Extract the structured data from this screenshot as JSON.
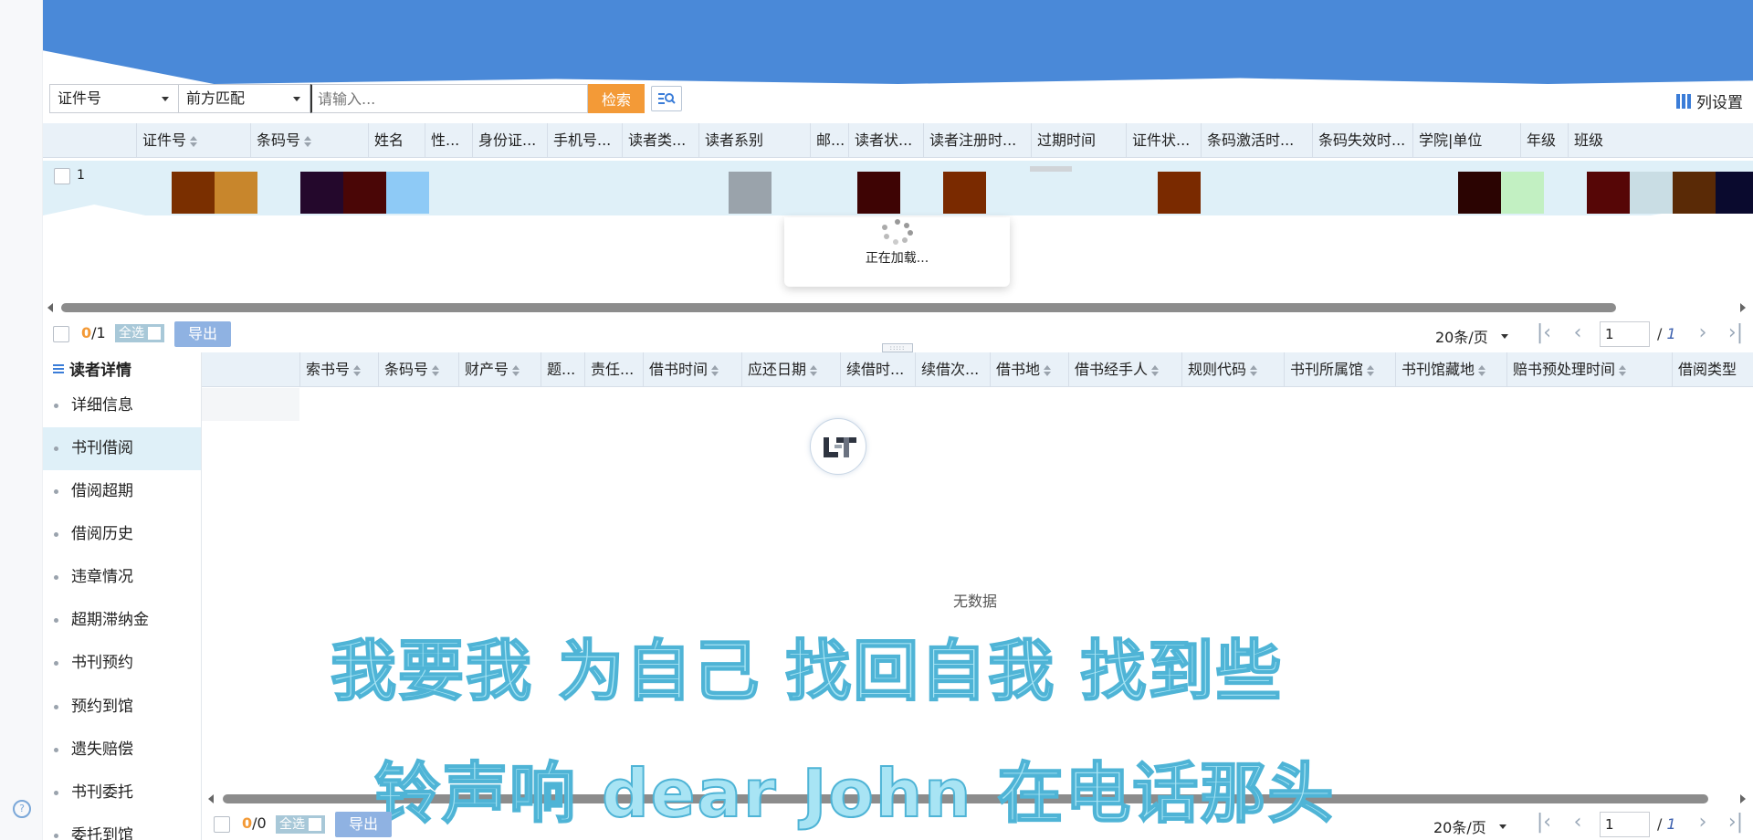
{
  "search": {
    "field_select": "证件号",
    "match_select": "前方匹配",
    "placeholder": "请输入...",
    "search_label": "检索",
    "column_settings_label": "列设置"
  },
  "upper_table": {
    "columns": [
      "证件号",
      "条码号",
      "姓名",
      "性...",
      "身份证...",
      "手机号...",
      "读者类...",
      "读者系别",
      "邮...",
      "读者状...",
      "读者注册时...",
      "过期时间",
      "证件状...",
      "条码激活时...",
      "条码失效时...",
      "学院|单位",
      "年级",
      "班级"
    ],
    "row_index": "1",
    "loading_text": "正在加载...",
    "swatch_colors": [
      "#7a2f00",
      "#c8862c",
      "#24082c",
      "#4a0606",
      "#8ecaf6",
      "#9aa3ab",
      "#3e0404",
      "#7a2a00",
      "#7a2a00",
      "#2b0402",
      "#c2f0c2",
      "#560606",
      "#c9dde4",
      "#5a2a06",
      "#0a0a2e"
    ]
  },
  "upper_pager": {
    "selected": "0",
    "total": "/1",
    "select_all": "全选",
    "export": "导出",
    "page_size": "20条/页",
    "page_input": "1",
    "page_sep": "/",
    "page_total": "1"
  },
  "sidebar": {
    "title": "读者详情",
    "items": [
      "详细信息",
      "书刊借阅",
      "借阅超期",
      "借阅历史",
      "违章情况",
      "超期滞纳金",
      "书刊预约",
      "预约到馆",
      "遗失赔偿",
      "书刊委托",
      "委托到馆"
    ],
    "active_index": 1
  },
  "lower_table": {
    "columns": [
      "索书号",
      "条码号",
      "财产号",
      "题...",
      "责任...",
      "借书时间",
      "应还日期",
      "续借时...",
      "续借次...",
      "借书地",
      "借书经手人",
      "规则代码",
      "书刊所属馆",
      "书刊馆藏地",
      "赔书预处理时间",
      "借阅类型"
    ],
    "empty_text": "无数据"
  },
  "lower_pager": {
    "selected": "0",
    "total": "/0",
    "select_all": "全选",
    "export": "导出",
    "page_size": "20条/页",
    "page_input": "1",
    "page_sep": "/",
    "page_total": "1"
  },
  "overlay_lyrics": {
    "line1": "我要我  为自己  找回自我  找到些",
    "line2": "铃声响 dear John 在电话那头"
  },
  "colors": {
    "banner": "#4a89d8",
    "accent_orange": "#f39a37",
    "header_bg": "#e9f1f8",
    "row_highlight": "#dff0f8"
  }
}
